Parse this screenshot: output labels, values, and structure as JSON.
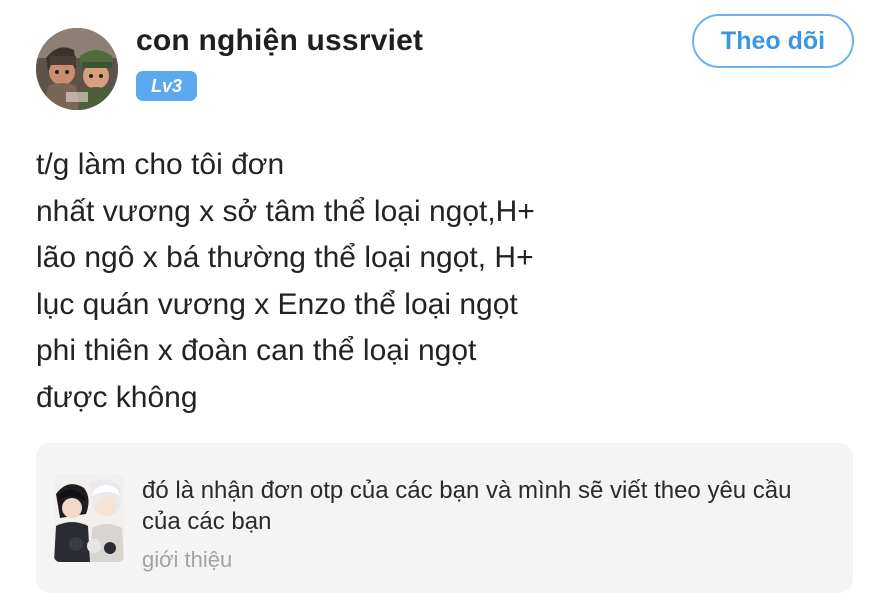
{
  "header": {
    "username": "con nghiện ussrviet",
    "level": "Lv3",
    "follow_label": "Theo dõi"
  },
  "content": {
    "lines": [
      "t/g làm cho tôi đơn",
      "nhất vương x sở tâm thể loại ngọt,H+",
      "lão ngô x bá thường thể loại ngọt, H+",
      "lục quán vương x Enzo thể loại ngọt",
      "phi thiên x đoàn can thể loại ngọt",
      "được không"
    ]
  },
  "quote": {
    "text": "đó là nhận đơn otp của các bạn và mình sẽ viết theo yêu cầu của các bạn",
    "category": "giới thiệu"
  },
  "colors": {
    "accent": "#3d95e3",
    "badge": "#5aa8ee",
    "card_bg": "#f4f4f4",
    "muted_text": "#a3a3a3"
  }
}
